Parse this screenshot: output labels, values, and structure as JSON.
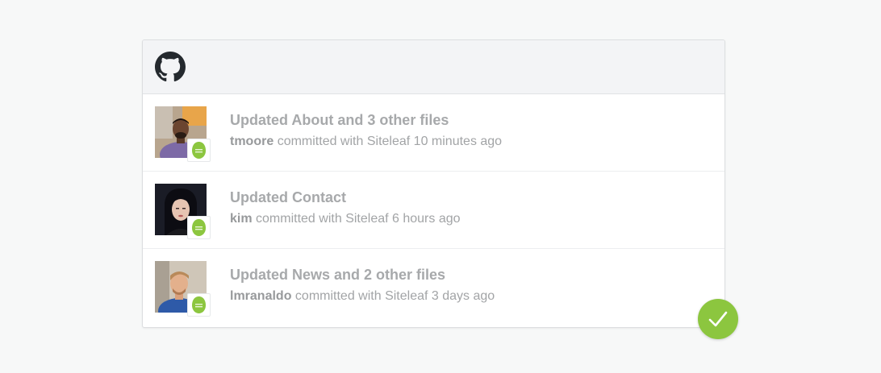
{
  "panel": {
    "header_icon": "github-icon",
    "commits": [
      {
        "title": "Updated About and 3 other files",
        "author": "tmoore",
        "action": "committed with",
        "app": "Siteleaf",
        "time": "10 minutes ago",
        "avatar": "avatar-photo",
        "badge_icon": "siteleaf-icon"
      },
      {
        "title": "Updated Contact",
        "author": "kim",
        "action": "committed with",
        "app": "Siteleaf",
        "time": "6 hours ago",
        "avatar": "avatar-photo",
        "badge_icon": "siteleaf-icon"
      },
      {
        "title": "Updated News and 2 other files",
        "author": "lmranaldo",
        "action": "committed with",
        "app": "Siteleaf",
        "time": "3 days ago",
        "avatar": "avatar-photo",
        "badge_icon": "siteleaf-icon"
      }
    ]
  },
  "status": {
    "icon": "checkmark-icon",
    "color": "#8cc63f"
  },
  "colors": {
    "background": "#f7f8f8",
    "header_bg": "#f3f4f6",
    "text": "#a7a9ab",
    "siteleaf_green": "#8cc63f"
  }
}
